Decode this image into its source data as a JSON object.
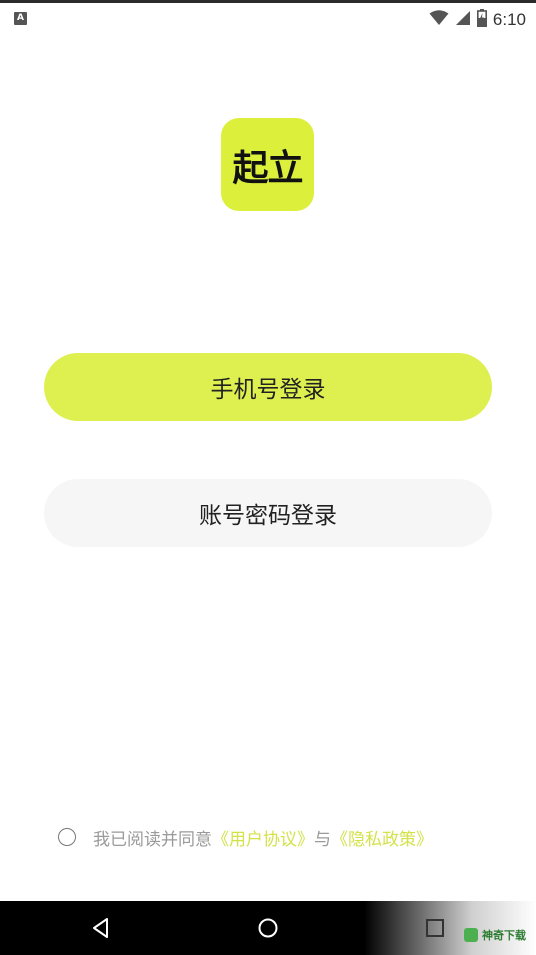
{
  "status_bar": {
    "notification_icon_letter": "A",
    "icons": [
      "wifi-icon",
      "signal-icon",
      "battery-icon"
    ],
    "time": "6:10"
  },
  "logo": {
    "text": "起立",
    "color": "#dcef3b"
  },
  "buttons": {
    "phone_login": "手机号登录",
    "account_login": "账号密码登录"
  },
  "agreement": {
    "prefix": "我已阅读并同意",
    "user_agreement": "《用户协议》",
    "conjunction": "与",
    "privacy_policy": "《隐私政策》",
    "checked": false
  },
  "nav_bar": {
    "icons": [
      "back-icon",
      "home-icon",
      "recent-apps-icon"
    ]
  },
  "watermark": {
    "text": "神奇下载"
  },
  "colors": {
    "accent": "#def050",
    "link": "#d4e24a",
    "secondary_button": "#f6f6f6"
  }
}
